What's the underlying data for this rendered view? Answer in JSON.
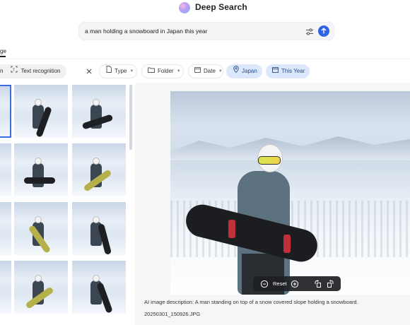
{
  "header": {
    "app_title": "Deep Search",
    "logo_icon": "gradient-orb-logo"
  },
  "search": {
    "query": "a man holding a snowboard in Japan this year",
    "settings_icon": "sliders-icon",
    "submit_icon": "arrow-up-icon",
    "accent": "#2f63e6"
  },
  "tabs": {
    "active_fragment": "ge"
  },
  "filters": {
    "text_fragment": "n",
    "text_recognition": "Text recognition",
    "clear_icon": "close-icon",
    "type": "Type",
    "folder": "Folder",
    "date": "Date",
    "location": "Japan",
    "period": "This Year",
    "active_chip_color": "#dbe8fb"
  },
  "viewer": {
    "reset_label": "Reset",
    "description": "AI image description: A man standing on top of a snow covered slope holding a snowboard.",
    "filename": "20250301_150926.JPG"
  }
}
